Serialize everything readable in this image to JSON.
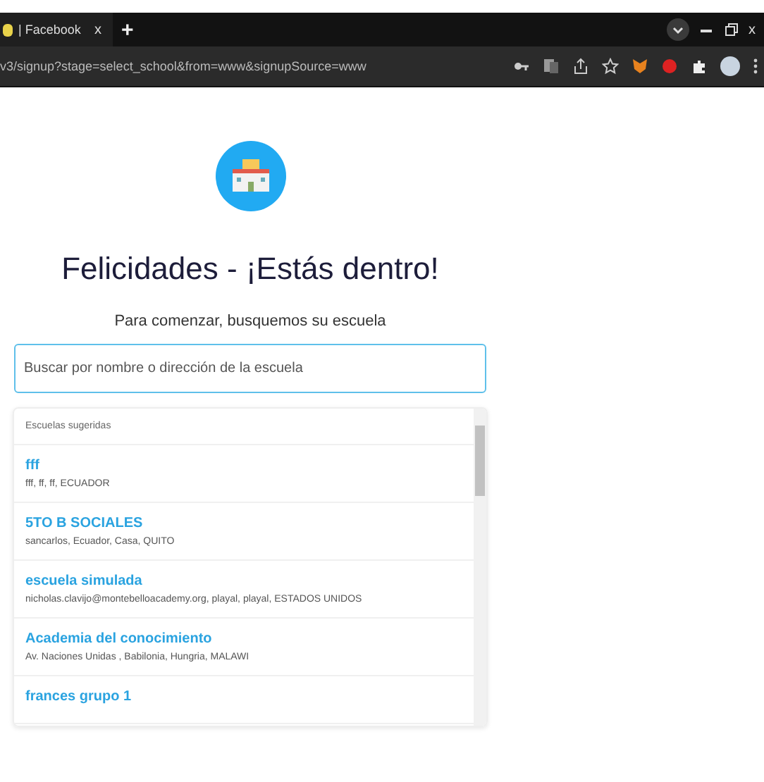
{
  "browser": {
    "tab": {
      "title": "| Facebook",
      "close": "x",
      "new_tab": "+"
    },
    "address": "v3/signup?stage=select_school&from=www&signupSource=www",
    "window_buttons": {
      "close": "x"
    }
  },
  "title": "Felicidades - ¡Estás dentro!",
  "subtitle": "Para comenzar, busquemos su escuela",
  "search": {
    "placeholder": "Buscar por nombre o dirección de la escuela"
  },
  "suggestions": {
    "heading": "Escuelas sugeridas",
    "items": [
      {
        "name": "fff",
        "address": "fff, ff, ff, ECUADOR"
      },
      {
        "name": "5TO B SOCIALES",
        "address": "sancarlos, Ecuador, Casa, QUITO"
      },
      {
        "name": "escuela simulada",
        "address": "nicholas.clavijo@montebelloacademy.org, playal, playal, ESTADOS UNIDOS"
      },
      {
        "name": "Academia del conocimiento",
        "address": "Av. Naciones Unidas , Babilonia, Hungria, MALAWI"
      },
      {
        "name": "frances grupo 1"
      }
    ]
  }
}
